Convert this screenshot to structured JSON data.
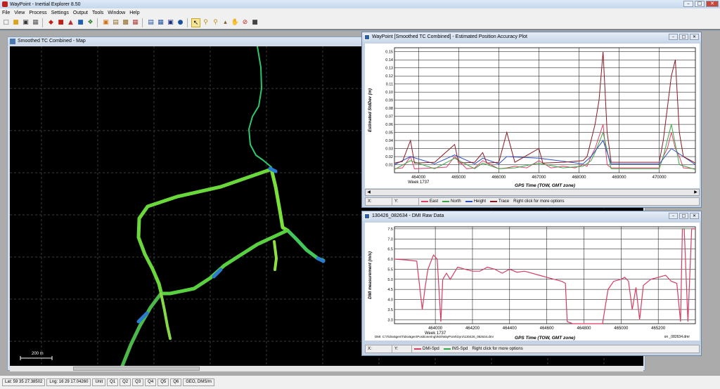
{
  "app": {
    "title": "WayPoint - Inertial Explorer 8.50"
  },
  "window_buttons": {
    "minimize": "–",
    "maximize": "□",
    "close": "✕"
  },
  "menu": [
    "File",
    "View",
    "Process",
    "Settings",
    "Output",
    "Tools",
    "Window",
    "Help"
  ],
  "toolbar_icons": [
    "new-icon",
    "open-icon",
    "save-icon",
    "print-icon",
    "data-icon",
    "convert-icon",
    "gnss-icon",
    "imu-icon",
    "process-icon",
    "combine-icon",
    "plot-icon",
    "export-icon",
    "map-icon",
    "chart-icon",
    "table-icon",
    "disk-icon",
    "globe-icon",
    "pointer-icon",
    "zoom-in-icon",
    "zoom-out-icon",
    "measure-icon",
    "pan-icon",
    "stop-icon",
    "window-icon"
  ],
  "map_window": {
    "title": "Smoothed TC Combined - Map",
    "scale_label": "200 m"
  },
  "accuracy_window": {
    "title": "WayPoint [Smoothed TC Combined] - Estimated Position Accuracy Plot",
    "status": {
      "x_label": "X:",
      "y_label": "Y:",
      "hint": "Right click for more options"
    },
    "colors": {
      "east": "#e0406a",
      "north": "#3aa845",
      "height": "#2c4fc0",
      "trace": "#8a1a24"
    }
  },
  "dmi_window": {
    "title": "130426_082634 - DMI Raw Data",
    "file_path": "DMI: C:\\Tidsvägen\\Tidsvägen\\Positionering\\INS\\WayPoint\\Gyro\\130426_082634.dmr",
    "file_short": "on _082634.dmr",
    "status": {
      "x_label": "X:",
      "y_label": "Y:",
      "hint": "Right click for more options"
    },
    "colors": {
      "dmi": "#d83c62",
      "ins": "#2ea84a"
    }
  },
  "chart_data": [
    {
      "type": "line",
      "title": "",
      "xlabel": "GPS Time (TOW, GMT zone)",
      "ylabel": "Estimated StdDev (m)",
      "week_label": "Week 1737",
      "xlim": [
        463400,
        470900
      ],
      "ylim": [
        0,
        0.155
      ],
      "x_ticks": [
        464000,
        465000,
        466000,
        467000,
        468000,
        469000,
        470000
      ],
      "y_ticks": [
        0.01,
        0.02,
        0.03,
        0.04,
        0.05,
        0.06,
        0.07,
        0.08,
        0.09,
        0.1,
        0.11,
        0.12,
        0.13,
        0.14,
        0.15
      ],
      "grid": true,
      "legend_position": "bottom",
      "series": [
        {
          "name": "East",
          "x": [
            463400,
            463600,
            463800,
            463900,
            464400,
            464700,
            464900,
            465200,
            465400,
            465600,
            466000,
            466200,
            466400,
            466700,
            467000,
            467300,
            467600,
            467900,
            468100,
            468200,
            468300,
            468400,
            468600,
            468700,
            468800,
            469000,
            469500,
            470000,
            470100,
            470200,
            470300,
            470400,
            470500,
            470600,
            470900
          ],
          "y": [
            0.005,
            0.006,
            0.02,
            0.005,
            0.006,
            0.007,
            0.02,
            0.005,
            0.006,
            0.015,
            0.005,
            0.006,
            0.008,
            0.006,
            0.015,
            0.006,
            0.008,
            0.006,
            0.01,
            0.008,
            0.02,
            0.03,
            0.06,
            0.01,
            0.006,
            0.006,
            0.006,
            0.006,
            0.02,
            0.03,
            0.05,
            0.03,
            0.02,
            0.006,
            0.005
          ]
        },
        {
          "name": "North",
          "x": [
            463400,
            463800,
            464400,
            464900,
            465400,
            465600,
            466000,
            466400,
            467000,
            467600,
            468100,
            468300,
            468400,
            468600,
            468800,
            469500,
            470000,
            470100,
            470300,
            470500,
            470900
          ],
          "y": [
            0.004,
            0.015,
            0.005,
            0.018,
            0.005,
            0.012,
            0.005,
            0.006,
            0.012,
            0.006,
            0.008,
            0.015,
            0.025,
            0.05,
            0.005,
            0.005,
            0.005,
            0.02,
            0.06,
            0.01,
            0.004
          ]
        },
        {
          "name": "Height",
          "x": [
            463400,
            463800,
            464400,
            464900,
            465400,
            465600,
            466000,
            466200,
            467000,
            468100,
            468300,
            468600,
            468800,
            469500,
            470000,
            470300,
            470900
          ],
          "y": [
            0.01,
            0.02,
            0.011,
            0.022,
            0.011,
            0.018,
            0.011,
            0.02,
            0.018,
            0.011,
            0.02,
            0.04,
            0.011,
            0.011,
            0.011,
            0.03,
            0.01
          ]
        },
        {
          "name": "Trace",
          "x": [
            463400,
            463600,
            463800,
            463900,
            464400,
            464900,
            465000,
            465400,
            465600,
            465700,
            466000,
            466200,
            466400,
            467000,
            467100,
            467600,
            468100,
            468200,
            468300,
            468400,
            468500,
            468600,
            468700,
            468800,
            469000,
            469500,
            470000,
            470100,
            470200,
            470300,
            470400,
            470500,
            470600,
            470900
          ],
          "y": [
            0.012,
            0.014,
            0.04,
            0.012,
            0.013,
            0.035,
            0.012,
            0.013,
            0.025,
            0.012,
            0.013,
            0.05,
            0.013,
            0.03,
            0.012,
            0.013,
            0.015,
            0.02,
            0.04,
            0.06,
            0.09,
            0.15,
            0.05,
            0.013,
            0.013,
            0.013,
            0.013,
            0.04,
            0.08,
            0.12,
            0.14,
            0.05,
            0.02,
            0.012
          ]
        }
      ]
    },
    {
      "type": "line",
      "title": "",
      "xlabel": "GPS Time (TOW, GMT zone)",
      "ylabel": "DMI measurement (m/s)",
      "week_label": "Week 1737",
      "xlim": [
        463780,
        465400
      ],
      "ylim": [
        2.8,
        7.6
      ],
      "x_ticks": [
        464000,
        464200,
        464400,
        464600,
        464800,
        465000,
        465200
      ],
      "y_ticks": [
        3.0,
        3.5,
        4.0,
        4.5,
        5.0,
        5.5,
        6.0,
        6.5,
        7.0,
        7.5
      ],
      "grid": true,
      "legend_position": "bottom",
      "series": [
        {
          "name": "DMI-Spd",
          "x": [
            463780,
            463850,
            463900,
            463930,
            463945,
            463960,
            463990,
            464010,
            464030,
            464040,
            464060,
            464080,
            464120,
            464160,
            464200,
            464240,
            464280,
            464320,
            464360,
            464400,
            464440,
            464480,
            464520,
            464560,
            464600,
            464640,
            464680,
            464700,
            464710,
            464740,
            464900,
            464930,
            464960,
            465000,
            465020,
            465040,
            465060,
            465080,
            465100,
            465120,
            465160,
            465200,
            465240,
            465270,
            465300,
            465320,
            465330,
            465340,
            465360,
            465380,
            465400
          ],
          "y": [
            6.0,
            5.95,
            5.9,
            3.5,
            4.6,
            5.5,
            6.2,
            6.0,
            2.9,
            5.0,
            5.3,
            5.0,
            5.6,
            5.5,
            5.4,
            5.4,
            5.6,
            5.5,
            5.3,
            5.5,
            5.35,
            5.4,
            5.3,
            5.2,
            5.1,
            5.0,
            4.9,
            4.8,
            2.9,
            2.8,
            2.8,
            4.5,
            4.9,
            5.0,
            5.1,
            4.9,
            3.5,
            4.6,
            3.0,
            4.7,
            5.0,
            5.1,
            5.2,
            4.9,
            4.8,
            2.9,
            7.5,
            7.5,
            2.9,
            7.5,
            7.5
          ]
        },
        {
          "name": "INS-Spd",
          "x": [
            465330,
            465345
          ],
          "y": [
            7.5,
            7.5
          ]
        }
      ]
    }
  ],
  "statusbar": {
    "lat": "Lat: 59 35 27.38502",
    "lng": "Lng: 16 29 17.04260",
    "unit": "Unit",
    "quality": [
      "Q1",
      "Q2",
      "Q3",
      "Q4",
      "Q5",
      "Q6"
    ],
    "coords": "GEO, DMS/m"
  }
}
